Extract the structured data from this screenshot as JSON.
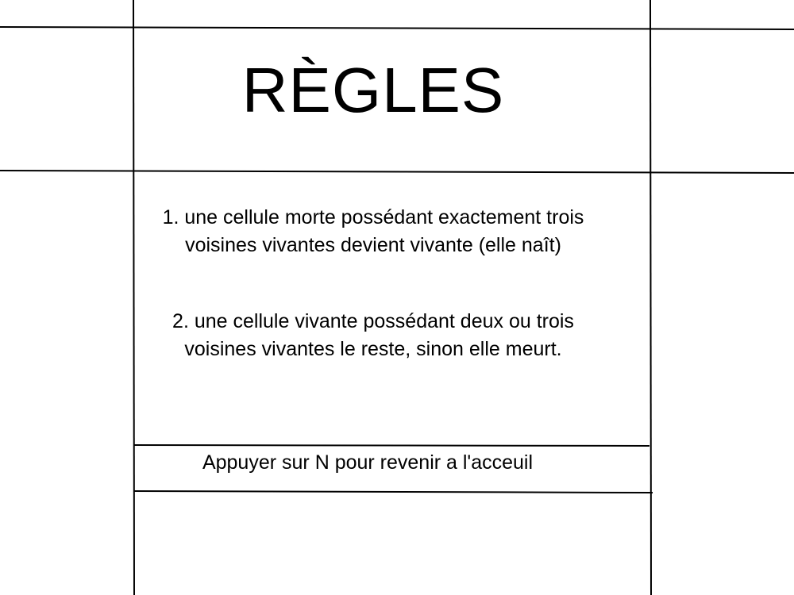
{
  "title": "RÈGLES",
  "rules": [
    {
      "line1": "1. une cellule morte possédant exactement trois",
      "line2": "voisines vivantes devient vivante (elle naît)"
    },
    {
      "line1": "2. une cellule vivante possédant deux ou trois",
      "line2": "voisines vivantes le reste, sinon elle meurt."
    }
  ],
  "footer": "Appuyer sur N pour revenir a l'acceuil"
}
